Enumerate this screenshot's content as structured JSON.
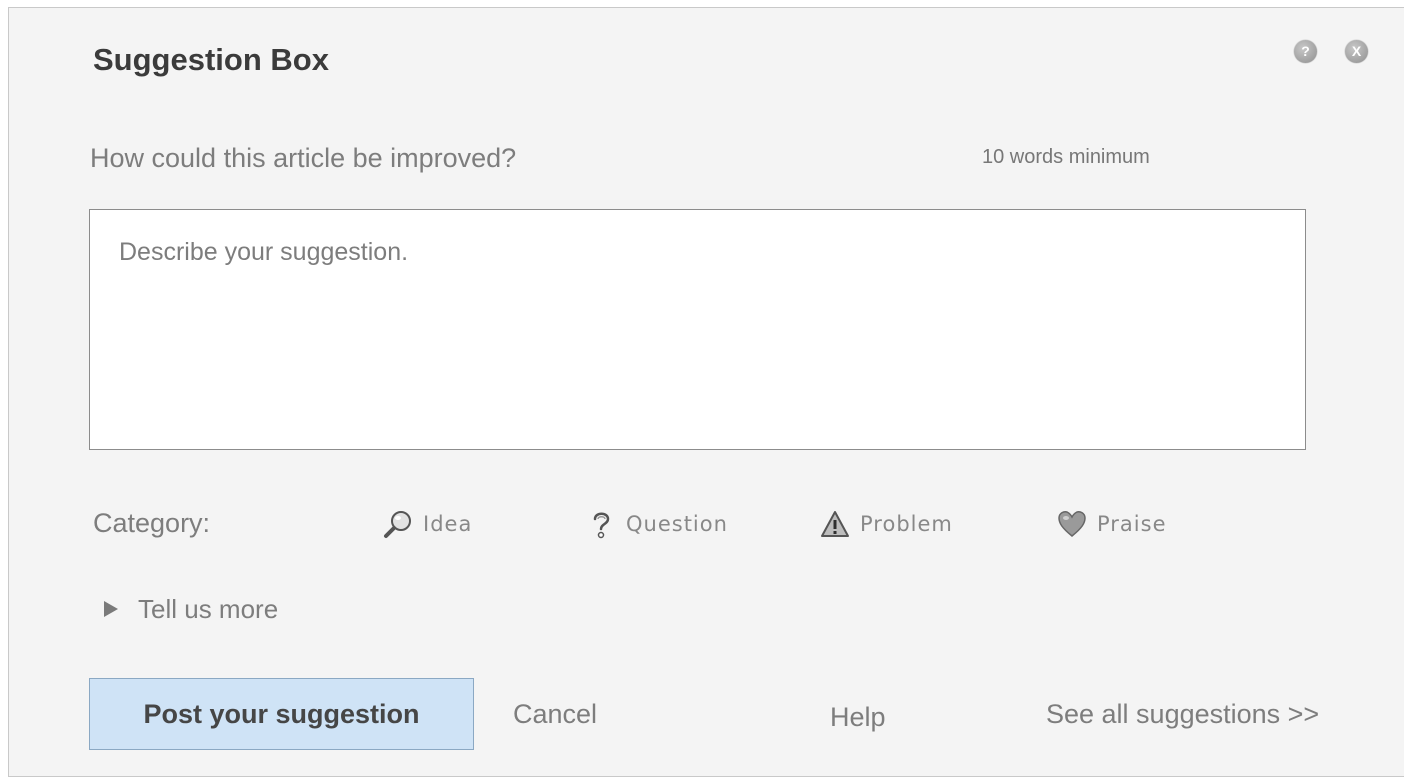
{
  "dialog": {
    "title": "Suggestion Box",
    "help_icon": "question-mark",
    "close_icon": "x-mark",
    "help_glyph": "?",
    "close_glyph": "X"
  },
  "prompt": {
    "question": "How could this article be improved?",
    "min_words_note": "10 words minimum"
  },
  "suggestion_input": {
    "value": "",
    "placeholder": "Describe your suggestion."
  },
  "category": {
    "label": "Category:",
    "options": [
      {
        "label": "Idea",
        "icon": "magnifier-icon"
      },
      {
        "label": "Question",
        "icon": "question-icon"
      },
      {
        "label": "Problem",
        "icon": "warning-icon"
      },
      {
        "label": "Praise",
        "icon": "heart-icon"
      }
    ]
  },
  "tell_more": {
    "label": "Tell us more"
  },
  "footer": {
    "post_label": "Post your suggestion",
    "cancel_label": "Cancel",
    "help_label": "Help",
    "see_all_label": "See all suggestions >>"
  },
  "colors": {
    "panel_bg": "#f4f4f4",
    "primary_button_bg": "#cfe3f6",
    "text_muted": "#7d7d7d",
    "title_text": "#3b3b3b"
  }
}
